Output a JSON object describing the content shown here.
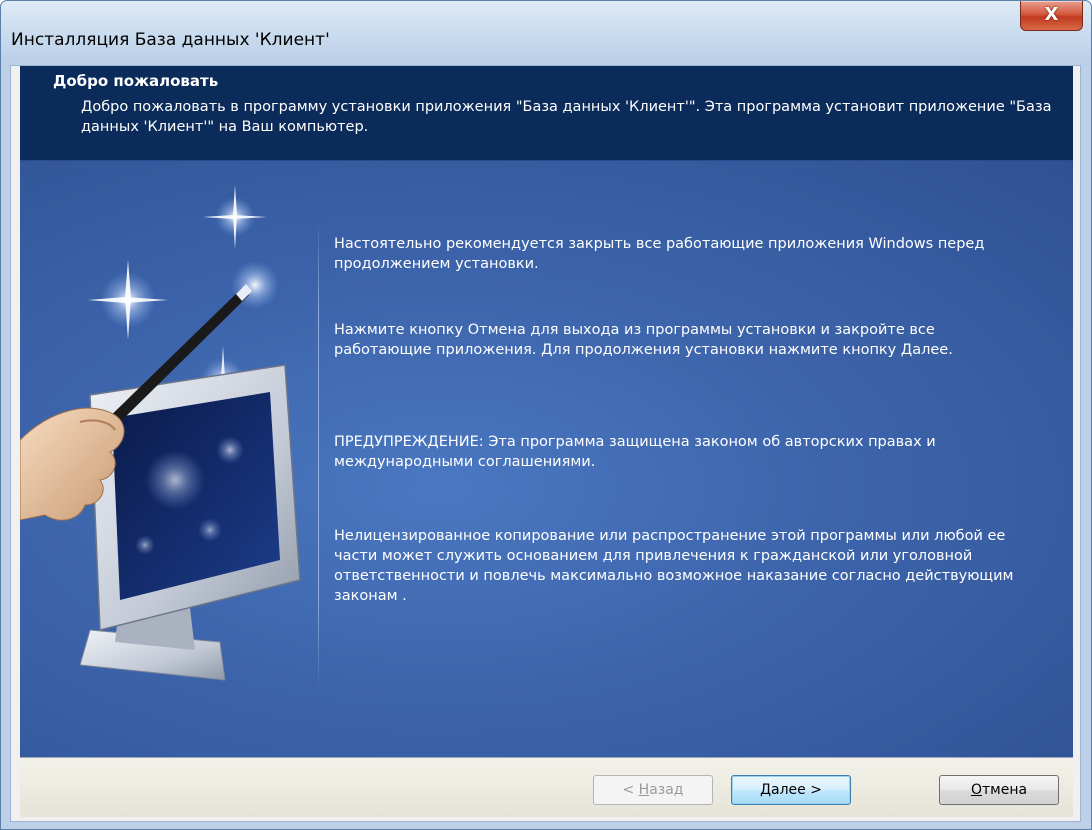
{
  "window": {
    "title": "Инсталляция База данных 'Клиент'",
    "close_glyph": "X"
  },
  "header": {
    "title": "Добро пожаловать",
    "description": "Добро пожаловать в программу установки приложения \"База данных 'Клиент'\". Эта программа установит приложение \"База данных 'Клиент'\" на Ваш компьютер."
  },
  "body": {
    "paragraphs": [
      "Настоятельно рекомендуется закрыть все работающие приложения Windows перед продолжением установки.",
      "Нажмите кнопку Отмена для выхода из программы установки и закройте все работающие приложения. Для продолжения установки нажмите кнопку Далее.",
      "ПРЕДУПРЕЖДЕНИЕ: Эта программа защищена законом об авторских правах и международными соглашениями.",
      "Нелицензированное копирование или распространение этой программы или любой ее части может служить основанием для привлечения к гражданской или уголовной ответственности и повлечь максимально возможное наказание согласно действующим законам ."
    ]
  },
  "buttons": {
    "back_prefix": "< ",
    "back_hotkey": "Н",
    "back_rest": "азад",
    "next_hotkey": "Д",
    "next_rest": "алее >",
    "cancel_hotkey": "О",
    "cancel_rest": "тмена"
  },
  "colors": {
    "header_bg": "#0b2b5a",
    "panel_bg": "#3e66ad",
    "footer_bg": "#ece9d8",
    "close_red": "#c23a20"
  },
  "icons": {
    "illustration": "magic-wand-monitor-illustration"
  }
}
